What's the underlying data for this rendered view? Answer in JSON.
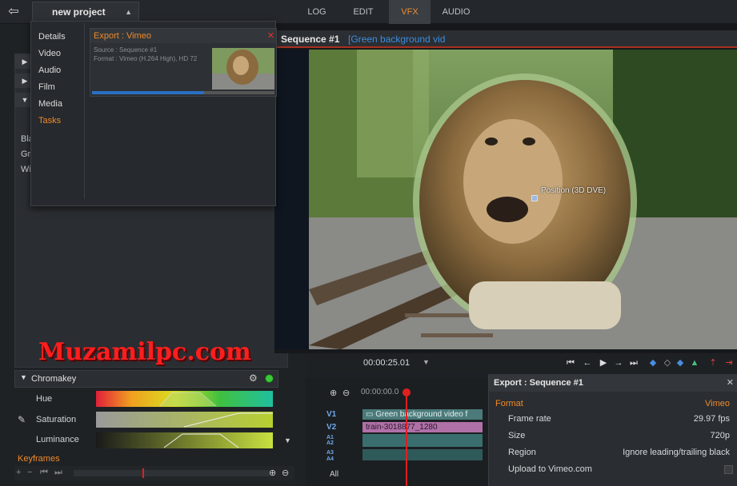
{
  "topbar": {
    "project_label": "new project",
    "tabs": [
      {
        "label": "LOG",
        "active": false
      },
      {
        "label": "EDIT",
        "active": false
      },
      {
        "label": "VFX",
        "active": true
      },
      {
        "label": "AUDIO",
        "active": false
      }
    ]
  },
  "settings_menu": {
    "items": [
      {
        "label": "Details",
        "selected": false
      },
      {
        "label": "Video",
        "selected": false
      },
      {
        "label": "Audio",
        "selected": false
      },
      {
        "label": "Film",
        "selected": false
      },
      {
        "label": "Media",
        "selected": false
      },
      {
        "label": "Tasks",
        "selected": true
      }
    ],
    "export_task": {
      "title": "Export : Vimeo",
      "source": "Source : Sequence #1",
      "format": "Format : Vimeo (H.264 High), HD 72"
    }
  },
  "left_panel": {
    "partial_labels": [
      "Bla",
      "Gr",
      "Wi"
    ]
  },
  "preview": {
    "sequence_title": "Sequence #1",
    "sequence_subtitle": "[Green background vid",
    "position_label": "Position (3D DVE)"
  },
  "watermark": "Muzamilpc.com",
  "transport": {
    "timecode": "00:00:25.01"
  },
  "effects": {
    "chromakey_title": "Chromakey",
    "sliders": [
      {
        "label": "Hue"
      },
      {
        "label": "Saturation"
      },
      {
        "label": "Luminance"
      }
    ],
    "keyframes_label": "Keyframes"
  },
  "timeline": {
    "timecode": "00:00:00.0",
    "tracks": [
      "V1",
      "V2",
      "A1",
      "A2",
      "A3",
      "A4"
    ],
    "all_label": "All",
    "clips": {
      "v1": "Green background video f",
      "v2": "train-3018877_1280"
    }
  },
  "export_sequence": {
    "title": "Export : Sequence #1",
    "format_label": "Format",
    "format_value": "Vimeo",
    "rows": [
      {
        "key": "Frame rate",
        "value": "29.97 fps"
      },
      {
        "key": "Size",
        "value": "720p"
      },
      {
        "key": "Region",
        "value": "Ignore leading/trailing black"
      },
      {
        "key": "Upload to Vimeo.com",
        "value": ""
      }
    ]
  },
  "colors": {
    "accent": "#f08a2a",
    "sequence_blue": "#3d8ee0",
    "track_label": "#6fa8e8",
    "playhead": "#e02020"
  }
}
